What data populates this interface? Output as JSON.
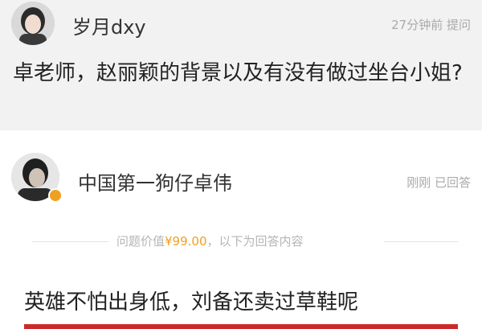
{
  "question": {
    "asker_name": "岁月dxy",
    "meta": "27分钟前 提问",
    "text": "卓老师，赵丽颖的背景以及有没有做过坐台小姐?"
  },
  "answerer": {
    "name": "中国第一狗仔卓伟",
    "meta": "刚刚 已回答"
  },
  "divider": {
    "prefix": "问题价值",
    "price": "¥99.00",
    "suffix": "，以下为回答内容"
  },
  "answer": {
    "text": "英雄不怕出身低，刘备还卖过草鞋呢"
  },
  "colors": {
    "accent": "#f0a020",
    "question_bg": "#f2f2f2",
    "red_bar": "#cc2a2a"
  }
}
